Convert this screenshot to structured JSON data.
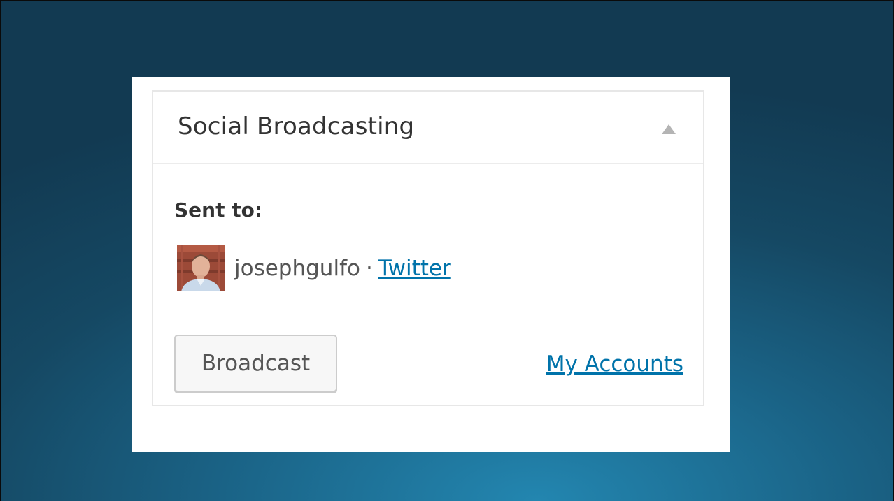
{
  "metabox": {
    "title": "Social Broadcasting",
    "toggle_icon": "triangle-up-icon",
    "sent_label": "Sent to:",
    "accounts": [
      {
        "username": "josephgulfo",
        "separator": "·",
        "service": "Twitter",
        "avatar_icon": "user-avatar"
      }
    ],
    "broadcast_label": "Broadcast",
    "my_accounts_label": "My Accounts"
  },
  "colors": {
    "link": "#0073aa",
    "text": "#333333",
    "muted_text": "#555555",
    "background_dark": "#123a52",
    "background_light": "#2386b0"
  }
}
